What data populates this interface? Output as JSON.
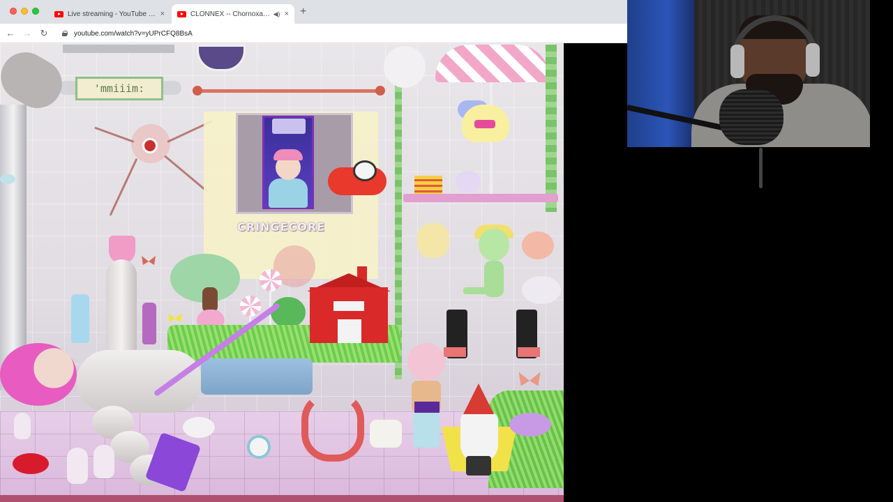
{
  "browser": {
    "tabs": [
      {
        "title": "Live streaming - YouTube Studio",
        "active": false
      },
      {
        "title": "CLONNEX -- Chornoxan -",
        "active": true
      }
    ],
    "new_tab_symbol": "+",
    "close_symbol": "×",
    "address": "youtube.com/watch?v=yUPrCFQ8BsA",
    "nav": {
      "back": "←",
      "forward": "→",
      "reload": "↻"
    }
  },
  "game": {
    "name_plate": "'mmiiim:",
    "sign_text": "CRINGECORE"
  },
  "colors": {
    "youtube_red": "#ff0000",
    "tab_bar": "#dee1e6",
    "barn_red": "#d92929",
    "accent_pink": "#f2a7c9"
  },
  "icons": {
    "tab_favicon": "youtube-icon",
    "audio": "speaker-icon",
    "lock": "lock-icon"
  }
}
